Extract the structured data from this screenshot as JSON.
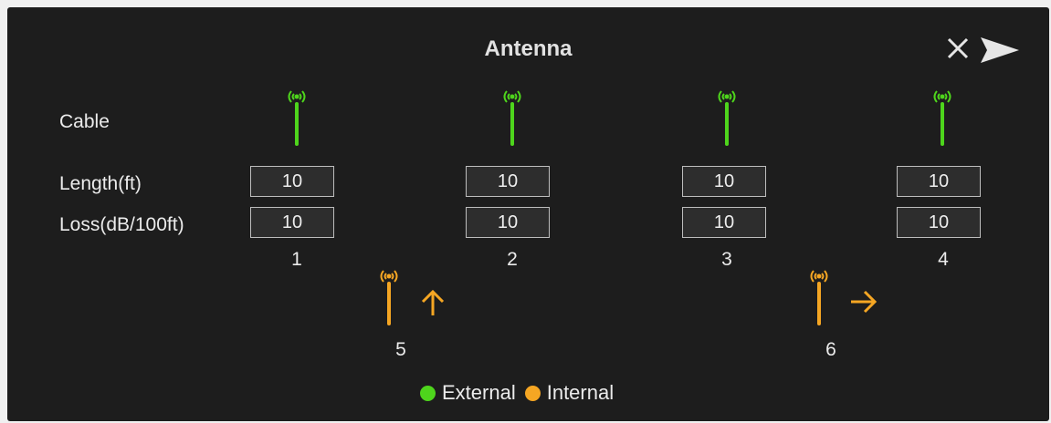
{
  "header": {
    "title": "Antenna",
    "close_icon": "close-icon",
    "send_icon": "send-icon"
  },
  "labels": {
    "cable": "Cable",
    "length": "Length(ft)",
    "loss": "Loss(dB/100ft)"
  },
  "colors": {
    "external": "#4ed51c",
    "internal": "#f5a623",
    "background": "#1d1d1d"
  },
  "external_antennas": [
    {
      "number": "1",
      "length": "10",
      "loss": "10"
    },
    {
      "number": "2",
      "length": "10",
      "loss": "10"
    },
    {
      "number": "3",
      "length": "10",
      "loss": "10"
    },
    {
      "number": "4",
      "length": "10",
      "loss": "10"
    }
  ],
  "internal_antennas": [
    {
      "number": "5",
      "direction": "up"
    },
    {
      "number": "6",
      "direction": "right"
    }
  ],
  "legend": {
    "external": "External",
    "internal": "Internal"
  }
}
